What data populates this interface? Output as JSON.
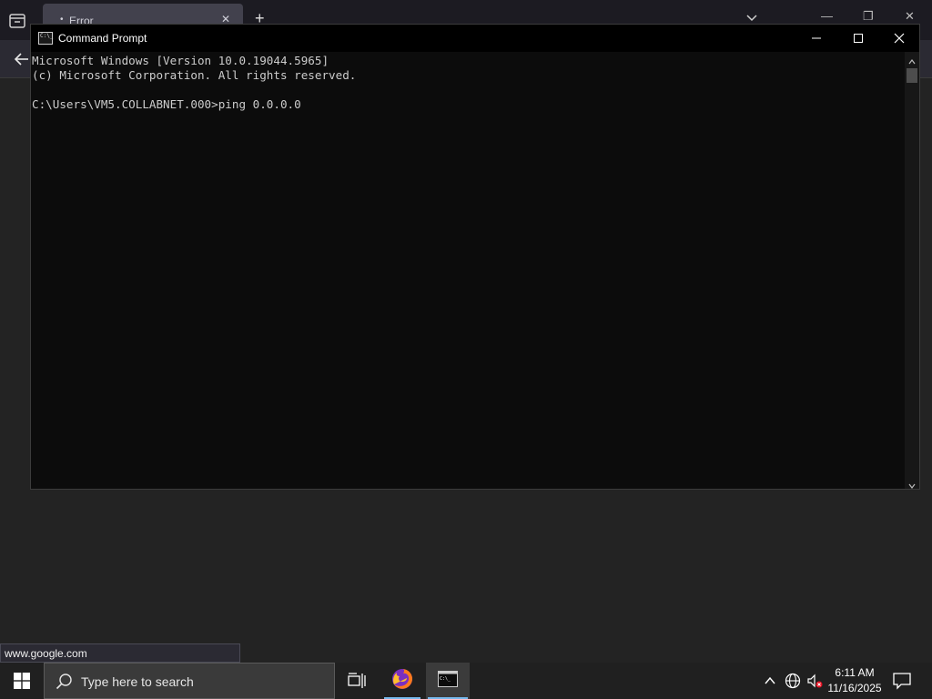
{
  "browser": {
    "tab_title": "Error",
    "tab_dot": "•",
    "tab_close": "✕",
    "new_tab": "+",
    "status_url": "www.google.com",
    "minimize_glyph": "—",
    "restore_glyph": "❐",
    "close_glyph": "✕"
  },
  "cmd": {
    "title": "Command Prompt",
    "icon_text": "C:\\_",
    "console_lines": [
      "Microsoft Windows [Version 10.0.19044.5965]",
      "(c) Microsoft Corporation. All rights reserved.",
      "",
      "C:\\Users\\VM5.COLLABNET.000>ping 0.0.0.0"
    ]
  },
  "taskbar": {
    "search_placeholder": "Type here to search",
    "clock_time": "6:11 AM",
    "clock_date": "11/16/2025",
    "active_underline_color": "#76b9ed"
  },
  "icons": [
    "windows-logo-icon",
    "search-icon",
    "task-view-icon",
    "firefox-icon",
    "cmd-icon",
    "chevron-up-icon",
    "network-icon",
    "volume-muted-icon",
    "notification-icon",
    "back-arrow-icon",
    "tab-list-icon"
  ]
}
